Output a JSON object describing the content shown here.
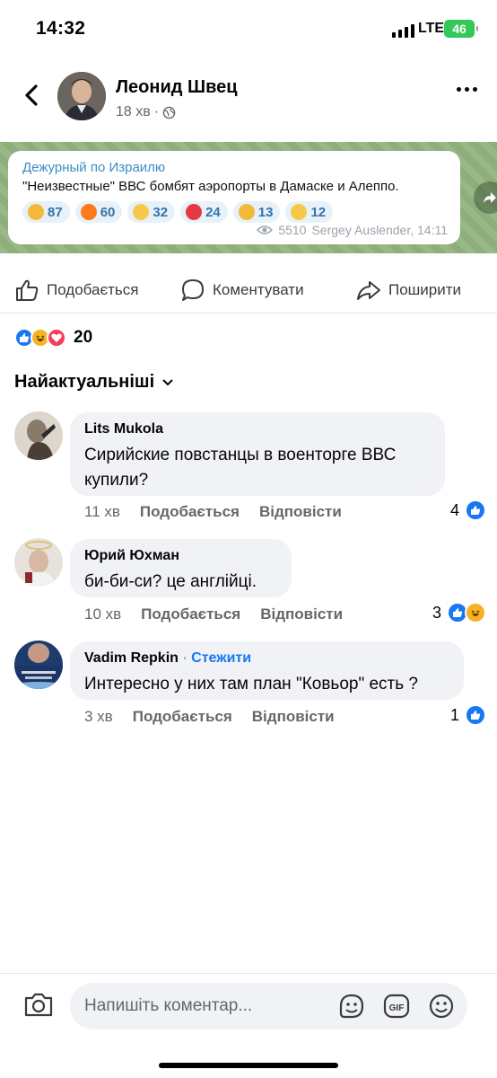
{
  "status_bar": {
    "time": "14:32",
    "network": "LTE",
    "battery": "46"
  },
  "post": {
    "author": "Леонид Швец",
    "time": "18 хв",
    "separator": "·"
  },
  "telegram": {
    "channel": "Дежурный по Израилю",
    "text": "\"Неизвестные\" ВВС бомбят аэропорты в Дамаске и Алеппо.",
    "reactions": [
      {
        "emoji": "thumbs-up",
        "count": "87",
        "color": "#f5b93a"
      },
      {
        "emoji": "fire",
        "count": "60",
        "color": "#ff7a1a"
      },
      {
        "emoji": "scream",
        "count": "32",
        "color": "#f6c94a"
      },
      {
        "emoji": "heart",
        "count": "24",
        "color": "#e63946"
      },
      {
        "emoji": "thumbs-down",
        "count": "13",
        "color": "#f5b93a"
      },
      {
        "emoji": "grin",
        "count": "12",
        "color": "#f6c94a"
      }
    ],
    "views": "5510",
    "signature": "Sergey Auslender, 14:11"
  },
  "actions": {
    "like": "Подобається",
    "comment": "Коментувати",
    "share": "Поширити"
  },
  "reactions_total": "20",
  "sort_label": "Найактуальніші",
  "comments": [
    {
      "name": "Lits Mukola",
      "text": "Сирийские  повстанцы в военторге ВВС купили?",
      "time": "11 хв",
      "like": "Подобається",
      "reply": "Відповісти",
      "reaction_count": "4",
      "reactions": [
        "like"
      ]
    },
    {
      "name": "Юрий Юхман",
      "text": "би-би-си? це англійці.",
      "time": "10 хв",
      "like": "Подобається",
      "reply": "Відповісти",
      "reaction_count": "3",
      "reactions": [
        "like",
        "haha"
      ]
    },
    {
      "name": "Vadim Repkin",
      "follow": "Стежити",
      "text": "Интересно у них там план \"Ковьор\" есть ?",
      "time": "3 хв",
      "like": "Подобається",
      "reply": "Відповісти",
      "reaction_count": "1",
      "reactions": [
        "like"
      ]
    }
  ],
  "composer": {
    "placeholder": "Напишіть коментар..."
  }
}
